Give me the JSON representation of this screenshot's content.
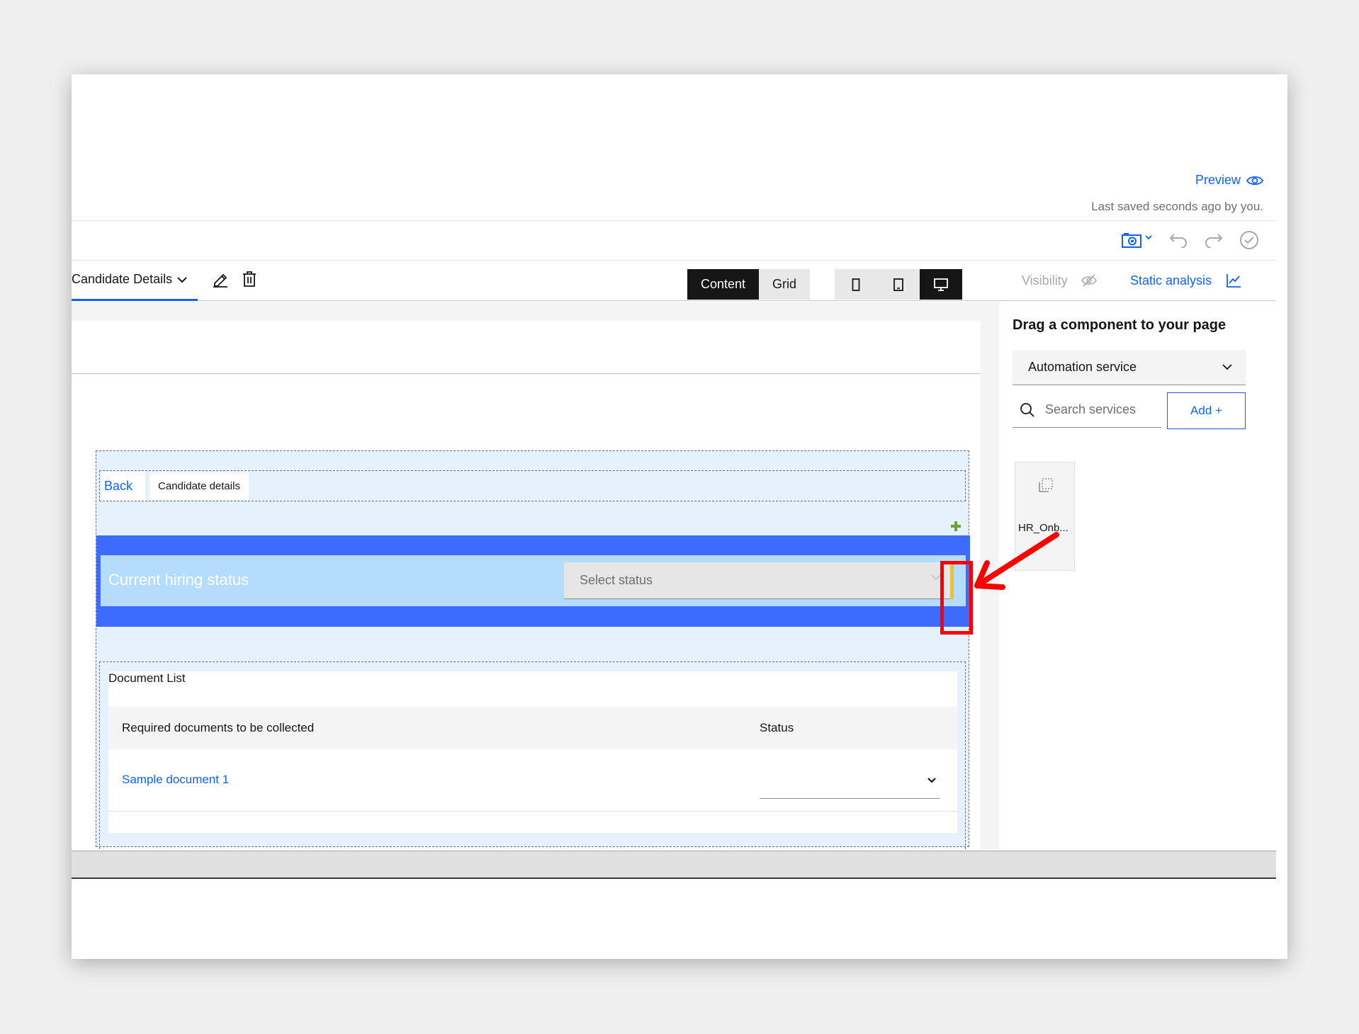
{
  "header": {
    "preview_label": "Preview",
    "last_saved": "Last saved seconds ago by you."
  },
  "tabbar": {
    "page_tab": "Candidate Details",
    "content_label": "Content",
    "grid_label": "Grid",
    "visibility_label": "Visibility",
    "static_analysis_label": "Static analysis"
  },
  "canvas": {
    "back_label": "Back",
    "breadcrumb_current": "Candidate details",
    "hiring_status_title": "Current hiring status",
    "status_placeholder": "Select status",
    "document_list": {
      "title": "Document List",
      "columns": [
        "Required documents to be collected",
        "Status"
      ],
      "rows": [
        {
          "document": "Sample document 1",
          "status": ""
        }
      ]
    }
  },
  "sidebar": {
    "title": "Drag a component to your page",
    "service_type": "Automation service",
    "search_placeholder": "Search services",
    "add_label": "Add +",
    "components": [
      {
        "label": "HR_Onb..."
      }
    ]
  },
  "colors": {
    "accent": "#0f62fe",
    "band": "#3d6bfd",
    "status_panel": "#b4dcfc",
    "handle": "#f1c21b",
    "annotation": "#ff0000"
  }
}
